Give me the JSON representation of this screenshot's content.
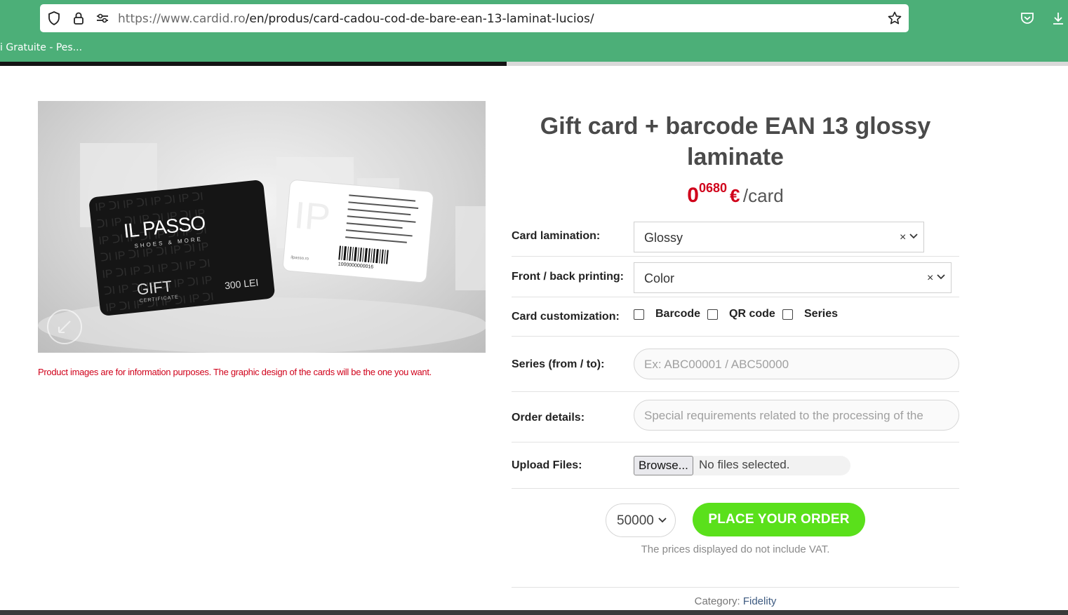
{
  "browser": {
    "url_host": "https://www.cardid.ro",
    "url_path": "/en/produs/card-cadou-cod-de-bare-ean-13-laminat-lucios/",
    "bookmark": "i Gratuite - Pes..."
  },
  "product": {
    "title": "Gift card + barcode EAN 13 glossy laminate",
    "price_int": "0",
    "price_dec": "0680",
    "price_currency": "€",
    "price_unit": "/card",
    "image_note": "Product images are for information purposes. The graphic design of the cards will be the one you want.",
    "image": {
      "brand": "IL PASSO",
      "brand_sub": "SHOES & MORE",
      "gift": "GIFT",
      "gift_sub": "CERTIFICATE",
      "amount": "300 LEI",
      "barcode_digits": "1000000000016"
    }
  },
  "form": {
    "lamination": {
      "label": "Card lamination:",
      "value": "Glossy"
    },
    "printing": {
      "label": "Front / back printing:",
      "value": "Color"
    },
    "customization": {
      "label": "Card customization:",
      "options": [
        "Barcode",
        "QR code",
        "Series"
      ]
    },
    "series": {
      "label": "Series (from / to):",
      "placeholder": "Ex: ABC00001 / ABC50000"
    },
    "details": {
      "label": "Order details:",
      "placeholder": "Special requirements related to the processing of the"
    },
    "upload": {
      "label": "Upload Files:",
      "button": "Browse...",
      "status": "No files selected."
    },
    "quantity": "50000",
    "order_button": "PLACE YOUR ORDER",
    "vat_note": "The prices displayed do not include VAT."
  },
  "meta": {
    "category_label": "Category:",
    "category": "Fidelity"
  },
  "colors": {
    "chrome": "#4caf78",
    "price": "#d0021b",
    "order_button": "#5ae01b",
    "note": "#d0021b"
  }
}
